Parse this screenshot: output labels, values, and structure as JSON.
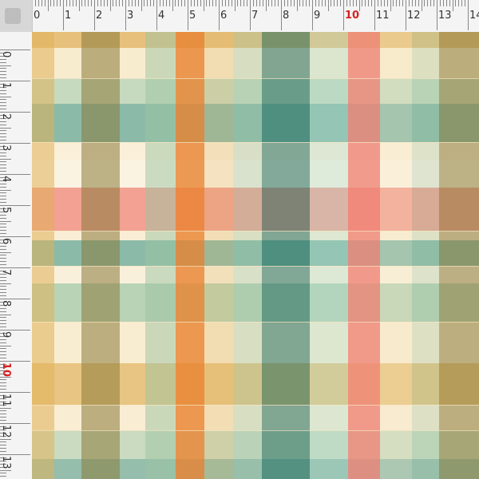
{
  "ruler": {
    "top_labels": [
      "0",
      "1",
      "2",
      "3",
      "4",
      "5",
      "6",
      "7",
      "8",
      "9",
      "10",
      "11",
      "12",
      "13",
      "14"
    ],
    "left_labels": [
      "0",
      "1",
      "2",
      "3",
      "4",
      "5",
      "6",
      "7",
      "8",
      "9",
      "10",
      "11",
      "12",
      "13"
    ],
    "highlight_label": "10",
    "highlight_color": "#d81f1f"
  },
  "pattern": {
    "description_colors": {
      "background": "#fbf3e2",
      "cream": "#f7e7c3",
      "sage": "#9bc4a2",
      "teal": "#2f8a78",
      "mint": "#a8d9cc",
      "coral": "#ef8577",
      "orange": "#e8822f",
      "ochre": "#e0b05a",
      "olive": "#8a7a3a",
      "deep_teal": "#1f6b5c",
      "brown": "#8c5a3a"
    }
  }
}
